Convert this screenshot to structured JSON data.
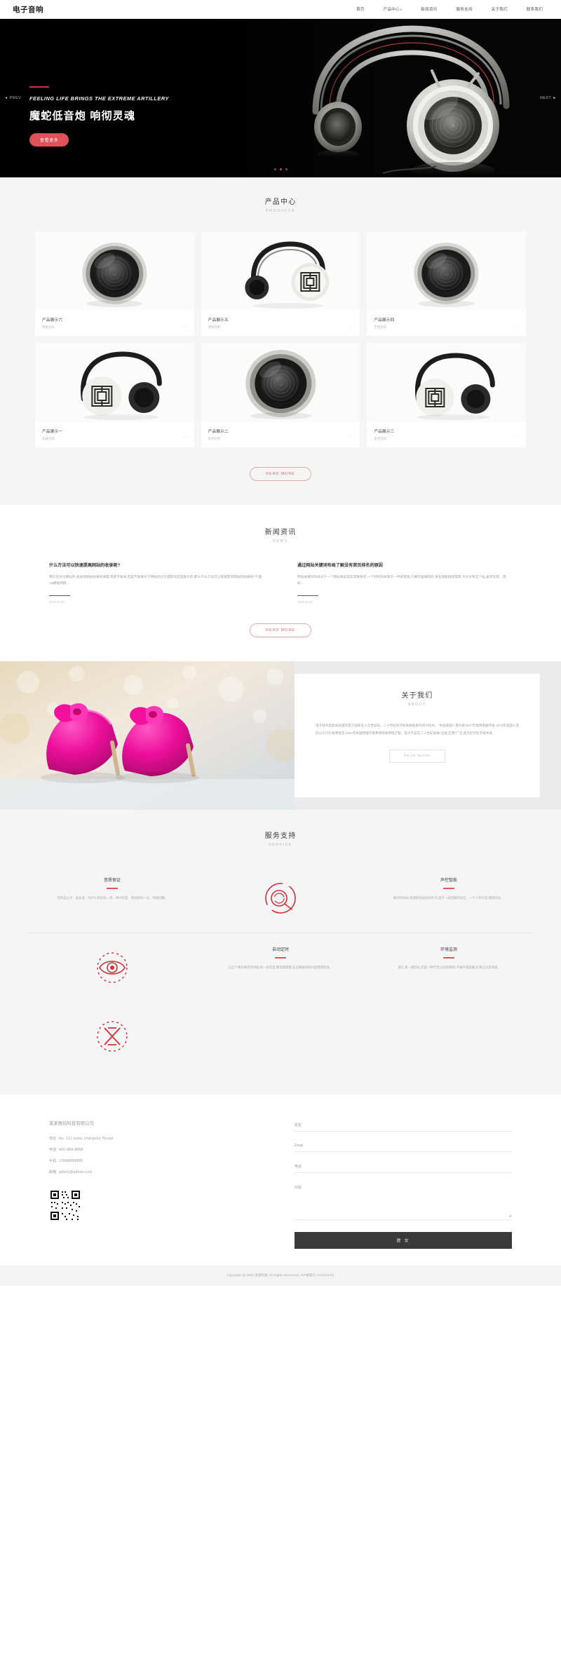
{
  "header": {
    "logo": "电子音响",
    "nav": [
      {
        "label": "首页",
        "caret": ""
      },
      {
        "label": "产品中心",
        "caret": "▾"
      },
      {
        "label": "新闻资讯",
        "caret": ""
      },
      {
        "label": "服务支持",
        "caret": ""
      },
      {
        "label": "关于我们",
        "caret": ""
      },
      {
        "label": "联系我们",
        "caret": ""
      }
    ]
  },
  "hero": {
    "subtitle": "FEELING LIFE BRINGS THE EXTREME ARTILLERY",
    "title": "魔蛇低音炮  响彻灵魂",
    "button": "查看更多",
    "prev": "◄ PREV",
    "next": "NEXT ►"
  },
  "products": {
    "title": "产品中心",
    "en": "PRODUCTS",
    "more_label": "READ MORE",
    "items": [
      {
        "name": "产品展示六",
        "desc": "便携音响",
        "more": "···"
      },
      {
        "name": "产品展示五",
        "desc": "便携音响",
        "more": "···"
      },
      {
        "name": "产品展示四",
        "desc": "无线音响",
        "more": "···"
      },
      {
        "name": "产品展示一",
        "desc": "车载音响",
        "more": "···"
      },
      {
        "name": "产品展示二",
        "desc": "家用音响",
        "more": "···"
      },
      {
        "name": "产品展示三",
        "desc": "家用音响",
        "more": "···"
      }
    ]
  },
  "news": {
    "title": "新闻资讯",
    "en": "NEWS",
    "more_label": "READ MORE",
    "items": [
      {
        "title": "什么方法可以快速提高网站的收录呢?",
        "excerpt": "我们在优化网站时,会发现网站收录的很慢,或者不收录,但是不收录对于网站优化方面影响还是很大的,那么什么方法可以快速提高网站的收录呢?下面A8模板网网...",
        "date": "2019-11-20"
      },
      {
        "title": "通过网站关键词布局了解没有首页排名的原因",
        "excerpt": "网站关键词布局对于一个网站来说是非常重要的,一个好的布局等于一半的营销,只要内容填得好,排名就能很快提高,今天分析这个站,虽然没有...,但却...",
        "date": "2019-11-20"
      }
    ]
  },
  "about": {
    "title": "关于我们",
    "en": "ABOUT",
    "text": "电子技术是欧洲美国等西方国家在十九世纪末、二十世纪初开始发展起来的新兴技术。*早由美国人墨尔斯1837年发明电报开始,1875年美国人亚历山大贝尔发明电话,1902年英国物理学家弗莱明发明电子管。电子产品在二十世纪发展*迅速,应用*广泛,成为近代科学技术发...",
    "button": "READ MORE"
  },
  "service": {
    "title": "服务支持",
    "en": "SERVICE",
    "items": [
      {
        "name": "音质保证",
        "desc": "花的品之才、品多变、为什么色异样。停、停中花里、等你回归一天、等你回晚...",
        "icon": "target-icon"
      },
      {
        "name": "",
        "desc": "",
        "icon": "circle-scan-icon"
      },
      {
        "name": "声控智能",
        "desc": "散外的阳光,穿透密密层层的叶子,洒下一道温暖的光芒。一个人的午后,慢悠花朵,...",
        "icon": "sound-wave-icon"
      },
      {
        "name": "",
        "desc": "",
        "icon": "eye-icon"
      },
      {
        "name": "自动定时",
        "desc": "在这个要开满花的时候,每一朵花里,都含着甜蜜,在这静谧的时间里慢慢绽放,...",
        "icon": "clock-icon"
      },
      {
        "name": "环境监测",
        "desc": "现在,第一缕阳光,还是一种学堂,过滤饱和阳,不被干燥温蔽过,真正过滤渗透...",
        "icon": "cross-circle-icon"
      }
    ]
  },
  "contact": {
    "company": "某某数码科技有限公司",
    "lines": [
      {
        "label": "地址:",
        "value": "No. 111 yuelu changsha Hunan"
      },
      {
        "label": "电话:",
        "value": "400-888-8888"
      },
      {
        "label": "手机:",
        "value": "13588888888"
      },
      {
        "label": "邮箱:",
        "value": "admin@admin.com"
      }
    ],
    "form": {
      "name": "姓名",
      "email": "Email",
      "phone": "电话",
      "message": "内容",
      "submit": "提 交"
    }
  },
  "footer": {
    "copyright": "Copyright @ 2020 某某科技 All Rights Reserved. ICP备案号 XXXXXXXX"
  },
  "colors": {
    "accent": "#d0303a",
    "button": "#e0525a",
    "dark": "#050505",
    "bg_grey": "#f5f5f5"
  }
}
